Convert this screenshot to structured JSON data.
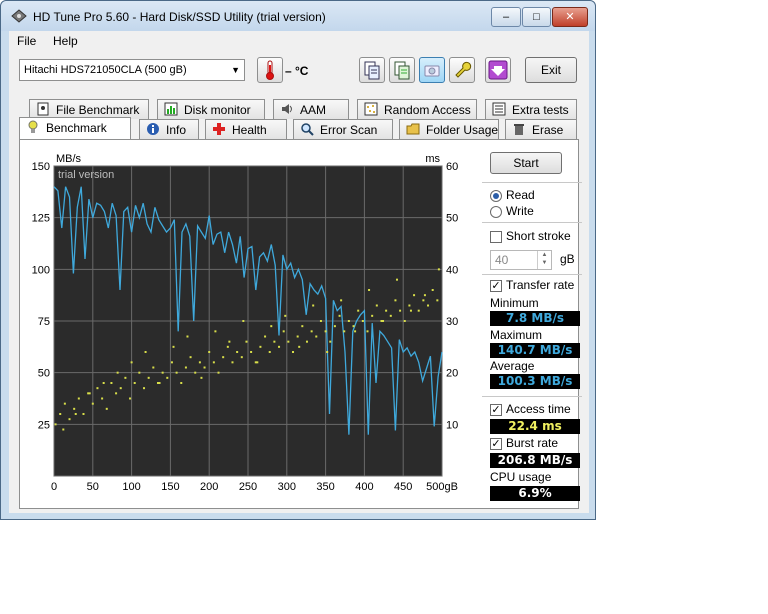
{
  "window": {
    "title": "HD Tune Pro 5.60 - Hard Disk/SSD Utility (trial version)",
    "buttons": {
      "minimize": "–",
      "maximize": "□",
      "close": "✕"
    }
  },
  "menu": {
    "file": "File",
    "help": "Help"
  },
  "toolbar": {
    "drive": "Hitachi HDS721050CLA (500 gB)",
    "temperature": "– °C",
    "exit_label": "Exit"
  },
  "tabs_top": [
    "File Benchmark",
    "Disk monitor",
    "AAM",
    "Random Access",
    "Extra tests"
  ],
  "tabs_bottom": [
    "Benchmark",
    "Info",
    "Health",
    "Error Scan",
    "Folder Usage",
    "Erase"
  ],
  "active_tab": "Benchmark",
  "colors": {
    "transfer": "#3fa9dc",
    "access": "#d8de4a",
    "chart_bg": "#2b2b2b",
    "grid": "#6a6a6a"
  },
  "side": {
    "start_label": "Start",
    "read_label": "Read",
    "write_label": "Write",
    "read_selected": true,
    "short_stroke_label": "Short stroke",
    "short_stroke_checked": false,
    "short_stroke_value": "40",
    "short_stroke_unit": "gB",
    "transfer_rate_label": "Transfer rate",
    "minimum_label": "Minimum",
    "minimum_value": "7.8 MB/s",
    "maximum_label": "Maximum",
    "maximum_value": "140.7 MB/s",
    "average_label": "Average",
    "average_value": "100.3 MB/s",
    "access_time_label": "Access time",
    "access_time_value": "22.4 ms",
    "burst_rate_label": "Burst rate",
    "burst_rate_value": "206.8 MB/s",
    "cpu_usage_label": "CPU usage",
    "cpu_usage_value": "6.9%"
  },
  "chart_data": {
    "type": "line",
    "watermark": "trial version",
    "left_unit": "MB/s",
    "right_unit": "ms",
    "x_ticks": [
      "0",
      "50",
      "100",
      "150",
      "200",
      "250",
      "300",
      "350",
      "400",
      "450",
      "500gB"
    ],
    "y_left_ticks": [
      "150",
      "125",
      "100",
      "75",
      "50",
      "25"
    ],
    "y_right_ticks": [
      "60",
      "50",
      "40",
      "30",
      "20",
      "10"
    ],
    "xlim": [
      0,
      500
    ],
    "ylim_left": [
      0,
      150
    ],
    "ylim_right": [
      0,
      60
    ],
    "grid": true,
    "series": [
      {
        "axis": "left",
        "color": "#3fa9dc",
        "x": [
          0,
          5,
          10,
          15,
          20,
          25,
          30,
          35,
          40,
          45,
          50,
          55,
          60,
          65,
          70,
          75,
          80,
          85,
          90,
          95,
          100,
          105,
          110,
          115,
          120,
          125,
          130,
          135,
          140,
          145,
          150,
          155,
          160,
          165,
          170,
          175,
          180,
          185,
          190,
          195,
          200,
          205,
          210,
          215,
          220,
          225,
          230,
          235,
          240,
          245,
          250,
          255,
          260,
          265,
          270,
          275,
          280,
          285,
          290,
          295,
          300,
          305,
          310,
          315,
          320,
          325,
          330,
          335,
          340,
          345,
          350,
          355,
          360,
          365,
          370,
          375,
          380,
          385,
          390,
          395,
          400,
          405,
          410,
          415,
          420,
          425,
          430,
          435,
          440,
          445,
          450,
          455,
          460,
          465,
          470,
          475,
          480,
          485,
          490,
          495,
          500
        ],
        "values": [
          140,
          138,
          120,
          140,
          135,
          98,
          130,
          140,
          105,
          134,
          125,
          132,
          131,
          128,
          120,
          132,
          126,
          90,
          128,
          130,
          118,
          131,
          125,
          132,
          122,
          118,
          130,
          124,
          121,
          118,
          120,
          124,
          70,
          118,
          122,
          116,
          75,
          121,
          118,
          115,
          126,
          112,
          117,
          118,
          108,
          118,
          112,
          103,
          116,
          96,
          110,
          111,
          90,
          106,
          108,
          104,
          112,
          102,
          68,
          107,
          100,
          103,
          96,
          100,
          95,
          78,
          93,
          90,
          88,
          92,
          86,
          30,
          85,
          80,
          82,
          60,
          20,
          70,
          75,
          78,
          80,
          20,
          74,
          45,
          70,
          68,
          65,
          62,
          22,
          66,
          60,
          62,
          58,
          60,
          55,
          46,
          52,
          58,
          24,
          48,
          60
        ]
      },
      {
        "axis": "right",
        "color": "#d8de4a",
        "style": "scatter",
        "x": [
          2,
          8,
          14,
          20,
          26,
          32,
          38,
          44,
          50,
          56,
          62,
          68,
          74,
          80,
          86,
          92,
          98,
          104,
          110,
          116,
          122,
          128,
          134,
          140,
          146,
          152,
          158,
          164,
          170,
          176,
          182,
          188,
          194,
          200,
          206,
          212,
          218,
          224,
          230,
          236,
          242,
          248,
          254,
          260,
          266,
          272,
          278,
          284,
          290,
          296,
          302,
          308,
          314,
          320,
          326,
          332,
          338,
          344,
          350,
          356,
          362,
          368,
          374,
          380,
          386,
          392,
          398,
          404,
          410,
          416,
          422,
          428,
          434,
          440,
          446,
          452,
          458,
          464,
          470,
          476,
          482,
          488,
          494,
          12,
          28,
          46,
          64,
          82,
          100,
          118,
          136,
          154,
          172,
          190,
          208,
          226,
          244,
          262,
          280,
          298,
          316,
          334,
          352,
          370,
          388,
          406,
          424,
          442,
          460,
          478,
          496
        ],
        "values": [
          10,
          12,
          14,
          11,
          13,
          15,
          12,
          16,
          14,
          17,
          15,
          13,
          18,
          16,
          17,
          19,
          15,
          18,
          20,
          17,
          19,
          21,
          18,
          20,
          19,
          22,
          20,
          18,
          21,
          23,
          20,
          22,
          21,
          24,
          22,
          20,
          23,
          25,
          22,
          24,
          23,
          26,
          24,
          22,
          25,
          27,
          24,
          26,
          25,
          28,
          26,
          24,
          27,
          29,
          26,
          28,
          27,
          30,
          28,
          26,
          29,
          31,
          28,
          30,
          29,
          32,
          30,
          28,
          31,
          33,
          30,
          32,
          31,
          34,
          32,
          30,
          33,
          35,
          32,
          34,
          33,
          36,
          34,
          9,
          12,
          16,
          18,
          20,
          22,
          24,
          18,
          25,
          27,
          19,
          28,
          26,
          30,
          22,
          29,
          31,
          25,
          33,
          24,
          34,
          28,
          36,
          30,
          38,
          32,
          35,
          40
        ]
      }
    ]
  }
}
